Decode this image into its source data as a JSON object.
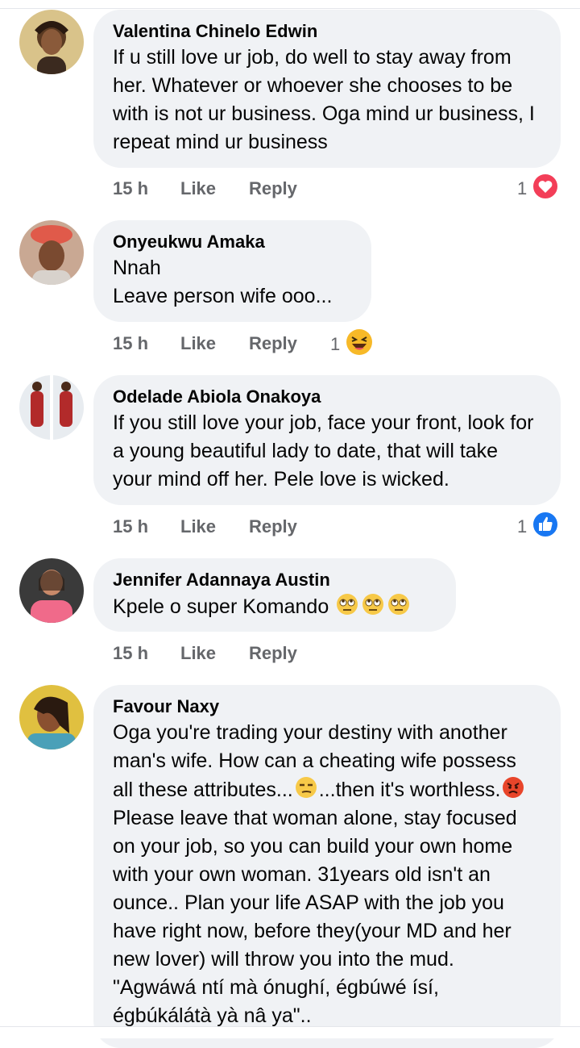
{
  "comments": [
    {
      "author": "Valentina Chinelo Edwin",
      "text": "If u still love ur job, do well to stay away from her. Whatever or whoever she chooses to be with is not ur business. Oga mind ur business, I repeat mind ur business",
      "time": "15 h",
      "like_label": "Like",
      "reply_label": "Reply",
      "reaction_count": "1",
      "reaction_icon": "heart-reaction-icon"
    },
    {
      "author": "Onyeukwu Amaka",
      "text": "Nnah\nLeave person wife ooo...",
      "time": "15 h",
      "like_label": "Like",
      "reply_label": "Reply",
      "reaction_count": "1",
      "reaction_icon": "haha-reaction-icon"
    },
    {
      "author": "Odelade Abiola Onakoya",
      "text": "If you still love your job, face your front, look for a young beautiful lady to date, that will take your mind off her. Pele love is wicked.",
      "time": "15 h",
      "like_label": "Like",
      "reply_label": "Reply",
      "reaction_count": "1",
      "reaction_icon": "like-reaction-icon"
    },
    {
      "author": "Jennifer Adannaya Austin",
      "text": "Kpele o super Komando",
      "time": "15 h",
      "like_label": "Like",
      "reply_label": "Reply"
    },
    {
      "author": "Favour Naxy",
      "text_1": "Oga you're trading your destiny with another man's wife. How can a cheating wife possess all these attributes...",
      "text_2": "...then it's worthless.",
      "text_3": " Please leave that woman alone, stay focused on your job, so you can build your own home with your own woman. 31years old isn't an ounce.. Plan your life ASAP with the job you have right now, before they(your MD and her new lover) will throw you into the mud. \"Agwáwá ntí mà ónughí, égbúwé ísí, égbúkálátà yà nâ ya\".."
    }
  ],
  "colors": {
    "bubble": "#f0f2f5",
    "meta": "#65676b",
    "like_blue": "#1877f2",
    "heart_red": "#f33e58"
  }
}
